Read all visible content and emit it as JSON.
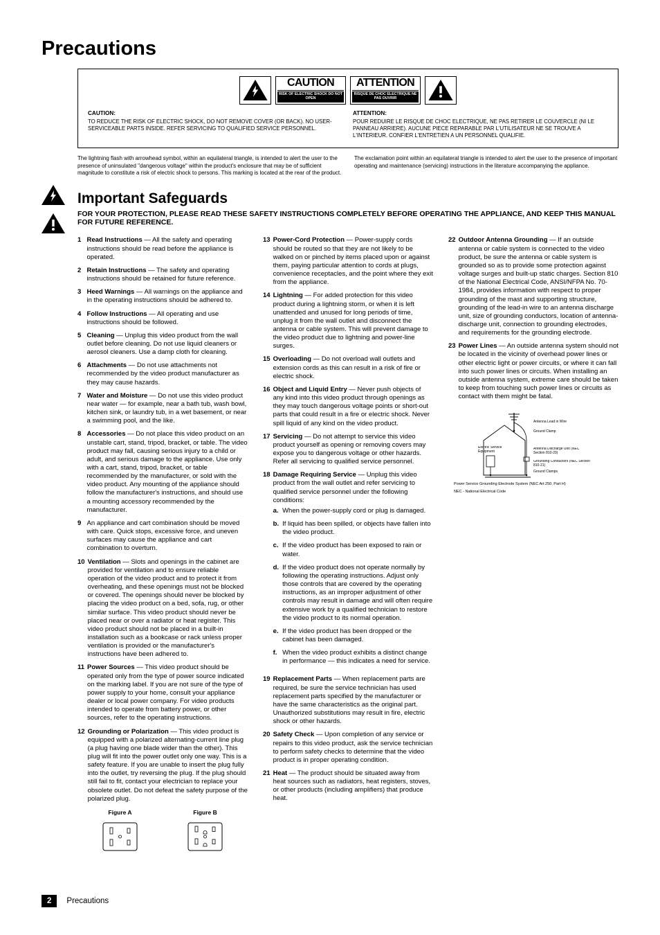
{
  "title": "Precautions",
  "warning_labels": {
    "lightning": "lightning-bolt-icon",
    "exclamation": "exclamation-icon",
    "caution_title": "CAUTION",
    "caution_sub": "RISK OF ELECTRIC SHOCK DO NOT OPEN",
    "attention_title": "ATTENTION",
    "attention_sub": "RISQUE DE CHOC ELECTRIQUE NE PAS OUVRIR"
  },
  "caution_text": {
    "en_title": "CAUTION:",
    "en_body": "TO REDUCE THE RISK OF ELECTRIC SHOCK, DO NOT REMOVE COVER (OR BACK). NO USER-SERVICEABLE PARTS INSIDE. REFER SERVICING TO QUALIFIED SERVICE PERSONNEL.",
    "fr_title": "ATTENTION:",
    "fr_body": "POUR REDUIRE LE RISQUE DE CHOC ELECTRIQUE, NE PAS RETIRER LE COUVERCLE (NI LE PANNEAU ARRIERE). AUCUNE PIECE REPARABLE PAR L'UTILISATEUR NE SE TROUVE A L'INTERIEUR. CONFIER L'ENTRETIEN A UN PERSONNEL QUALIFIE."
  },
  "symbol_desc": {
    "lightning": "The lightning flash with arrowhead symbol, within an equilateral triangle, is intended to alert the user to the presence of uninsulated \"dangerous voltage\" within the product's enclosure that may be of sufficient magnitude to constitute a risk of electric shock to persons. This marking is located at the rear of the product.",
    "exclamation": "The exclamation point within an equilateral triangle is intended to alert the user to the presence of important operating and maintenance (servicing) instructions in the literature accompanying the appliance."
  },
  "instructions_title": "Important Safeguards",
  "instructions_sub": "FOR YOUR PROTECTION, PLEASE READ THESE SAFETY INSTRUCTIONS COMPLETELY BEFORE OPERATING THE APPLIANCE, AND KEEP THIS MANUAL FOR FUTURE REFERENCE.",
  "instructions": {
    "i1": {
      "num": "1",
      "label": "Read Instructions",
      "text": " — All the safety and operating instructions should be read before the appliance is operated."
    },
    "i2": {
      "num": "2",
      "label": "Retain Instructions",
      "text": " — The safety and operating instructions should be retained for future reference."
    },
    "i3": {
      "num": "3",
      "label": "Heed Warnings",
      "text": " — All warnings on the appliance and in the operating instructions should be adhered to."
    },
    "i4": {
      "num": "4",
      "label": "Follow Instructions",
      "text": " — All operating and use instructions should be followed."
    },
    "i5": {
      "num": "5",
      "label": "Cleaning",
      "text": " — Unplug this video product from the wall outlet before cleaning. Do not use liquid cleaners or aerosol cleaners. Use a damp cloth for cleaning."
    },
    "i6": {
      "num": "6",
      "label": "Attachments",
      "text": " — Do not use attachments not recommended by the video product manufacturer as they may cause hazards."
    },
    "i7": {
      "num": "7",
      "label": "Water and Moisture",
      "text": " — Do not use this video product near water — for example, near a bath tub, wash bowl, kitchen sink, or laundry tub, in a wet basement, or near a swimming pool, and the like."
    },
    "i8": {
      "num": "8",
      "label": "Accessories",
      "text": " — Do not place this video product on an unstable cart, stand, tripod, bracket, or table. The video product may fall, causing serious injury to a child or adult, and serious damage to the appliance. Use only with a cart, stand, tripod, bracket, or table recommended by the manufacturer, or sold with the video product. Any mounting of the appliance should follow the manufacturer's instructions, and should use a mounting accessory recommended by the manufacturer."
    },
    "i9": {
      "num": "9",
      "label": "",
      "text": "An appliance and cart combination should be moved with care. Quick stops, excessive force, and uneven surfaces may cause the appliance and cart combination to overturn."
    },
    "i10": {
      "num": "10",
      "label": "Ventilation",
      "text": " — Slots and openings in the cabinet are provided for ventilation and to ensure reliable operation of the video product and to protect it from overheating, and these openings must not be blocked or covered. The openings should never be blocked by placing the video product on a bed, sofa, rug, or other similar surface. This video product should never be placed near or over a radiator or heat register. This video product should not be placed in a built-in installation such as a bookcase or rack unless proper ventilation is provided or the manufacturer's instructions have been adhered to."
    },
    "i11": {
      "num": "11",
      "label": "Power Sources",
      "text": " — This video product should be operated only from the type of power source indicated on the marking label. If you are not sure of the type of power supply to your home, consult your appliance dealer or local power company. For video products intended to operate from battery power, or other sources, refer to the operating instructions."
    },
    "i12": {
      "num": "12",
      "label": "Grounding or Polarization",
      "text": " — This video product is equipped with a polarized alternating-current line plug (a plug having one blade wider than the other). This plug will fit into the power outlet only one way. This is a safety feature. If you are unable to insert the plug fully into the outlet, try reversing the plug. If the plug should still fail to fit, contact your electrician to replace your obsolete outlet. Do not defeat the safety purpose of the polarized plug."
    },
    "i13": {
      "num": "13",
      "label": "Power-Cord Protection",
      "text": " — Power-supply cords should be routed so that they are not likely to be walked on or pinched by items placed upon or against them, paying particular attention to cords at plugs, convenience receptacles, and the point where they exit from the appliance."
    },
    "i14": {
      "num": "14",
      "label": "Lightning",
      "text": " — For added protection for this video product during a lightning storm, or when it is left unattended and unused for long periods of time, unplug it from the wall outlet and disconnect the antenna or cable system. This will prevent damage to the video product due to lightning and power-line surges."
    },
    "i15": {
      "num": "15",
      "label": "Overloading",
      "text": " — Do not overload wall outlets and extension cords as this can result in a risk of fire or electric shock."
    },
    "i16": {
      "num": "16",
      "label": "Object and Liquid Entry",
      "text": " — Never push objects of any kind into this video product through openings as they may touch dangerous voltage points or short-out parts that could result in a fire or electric shock. Never spill liquid of any kind on the video product."
    },
    "i17": {
      "num": "17",
      "label": "Servicing",
      "text": " — Do not attempt to service this video product yourself as opening or removing covers may expose you to dangerous voltage or other hazards. Refer all servicing to qualified service personnel."
    },
    "i18": {
      "num": "18",
      "label": "Damage Requiring Service",
      "text": " — Unplug this video product from the wall outlet and refer servicing to qualified service personnel under the following conditions:"
    },
    "i18a": {
      "num": "a.",
      "text": "When the power-supply cord or plug is damaged."
    },
    "i18b": {
      "num": "b.",
      "text": "If liquid has been spilled, or objects have fallen into the video product."
    },
    "i18c": {
      "num": "c.",
      "text": "If the video product has been exposed to rain or water."
    },
    "i18d": {
      "num": "d.",
      "text": "If the video product does not operate normally by following the operating instructions. Adjust only those controls that are covered by the operating instructions, as an improper adjustment of other controls may result in damage and will often require extensive work by a qualified technician to restore the video product to its normal operation."
    },
    "i18e": {
      "num": "e.",
      "text": "If the video product has been dropped or the cabinet has been damaged."
    },
    "i18f": {
      "num": "f.",
      "text": "When the video product exhibits a distinct change in performance — this indicates a need for service."
    },
    "i19": {
      "num": "19",
      "label": "Replacement Parts",
      "text": " — When replacement parts are required, be sure the service technician has used replacement parts specified by the manufacturer or have the same characteristics as the original part. Unauthorized substitutions may result in fire, electric shock or other hazards."
    },
    "i20": {
      "num": "20",
      "label": "Safety Check",
      "text": " — Upon completion of any service or repairs to this video product, ask the service technician to perform safety checks to determine that the video product is in proper operating condition."
    },
    "i21": {
      "num": "21",
      "label": "Heat",
      "text": " — The product should be situated away from heat sources such as radiators, heat registers, stoves, or other products (including amplifiers) that produce heat."
    },
    "i22": {
      "num": "22",
      "label": "Outdoor Antenna Grounding",
      "text": " — If an outside antenna or cable system is connected to the video product, be sure the antenna or cable system is grounded so as to provide some protection against voltage surges and built-up static charges. Section 810 of the National Electrical Code, ANSI/NFPA No. 70-1984, provides information with respect to proper grounding of the mast and supporting structure, grounding of the lead-in wire to an antenna discharge unit, size of grounding conductors, location of antenna-discharge unit, connection to grounding electrodes, and requirements for the grounding electrode."
    },
    "i23": {
      "num": "23",
      "label": "Power Lines",
      "text": " — An outside antenna system should not be located in the vicinity of overhead power lines or other electric light or power circuits, or where it can fall into such power lines or circuits. When installing an outside antenna system, extreme care should be taken to keep from touching such power lines or circuits as contact with them might be fatal."
    }
  },
  "fig_labels": {
    "a": "Figure A",
    "b": "Figure B"
  },
  "grounding_labels": {
    "a": "Antenna Lead in Wire",
    "b": "Ground Clamp",
    "c": "Antenna Discharge Unit (NEC Section 810-20)",
    "d": "Electric Service Equipment",
    "e": "Grounding Conductors (NEC Section 810-21)",
    "f": "Ground Clamps",
    "g": "Power Service Grounding Electrode System (NEC Art 250, Part H)",
    "h": "NEC - National Electrical Code"
  },
  "footer": {
    "page": "2",
    "text": "Precautions"
  }
}
